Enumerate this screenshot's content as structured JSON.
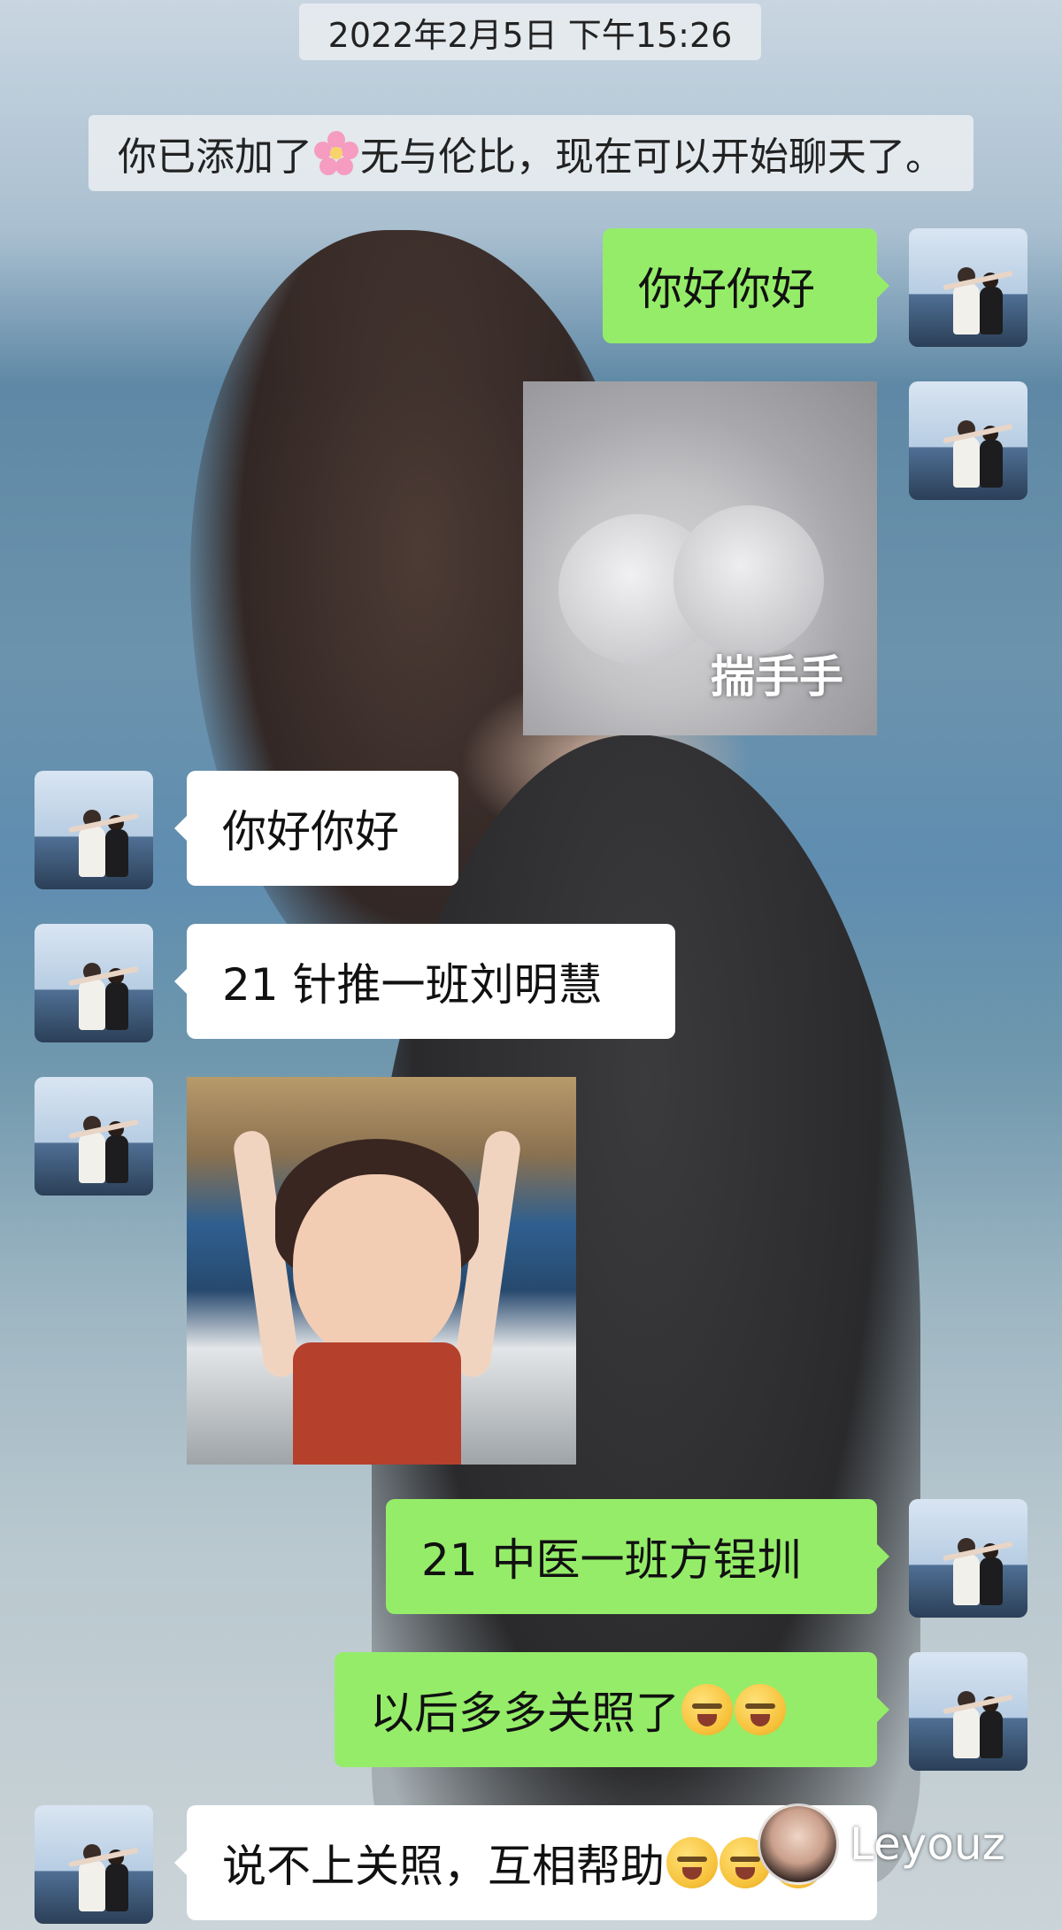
{
  "timestamp": "2022年2月5日 下午15:26",
  "system_message": {
    "prefix": "你已添加了",
    "contact_name": "无与伦比",
    "suffix": "，现在可以开始聊天了。",
    "name_icon": "pink-flower-icon"
  },
  "messages": [
    {
      "side": "right",
      "type": "text",
      "text": "你好你好"
    },
    {
      "side": "right",
      "type": "sticker",
      "caption": "揣手手",
      "sticker": "cat-paws-sticker"
    },
    {
      "side": "left",
      "type": "text",
      "text": "你好你好"
    },
    {
      "side": "left",
      "type": "text",
      "text": "21 针推一班刘明慧"
    },
    {
      "side": "left",
      "type": "sticker",
      "sticker": "girl-heart-sticker"
    },
    {
      "side": "right",
      "type": "text",
      "text": "21 中医一班方锃圳"
    },
    {
      "side": "right",
      "type": "text",
      "text": "以后多多关照了",
      "emoji": [
        "laugh-cry-emoji",
        "laugh-cry-emoji"
      ]
    },
    {
      "side": "left",
      "type": "text",
      "text": "说不上关照，互相帮助",
      "emoji": [
        "laugh-cry-emoji",
        "laugh-cry-emoji",
        "laugh-cry-emoji"
      ]
    }
  ],
  "watermark": {
    "text": "Leyouz"
  },
  "colors": {
    "sent_bubble": "#95ec69",
    "received_bubble": "#ffffff"
  }
}
